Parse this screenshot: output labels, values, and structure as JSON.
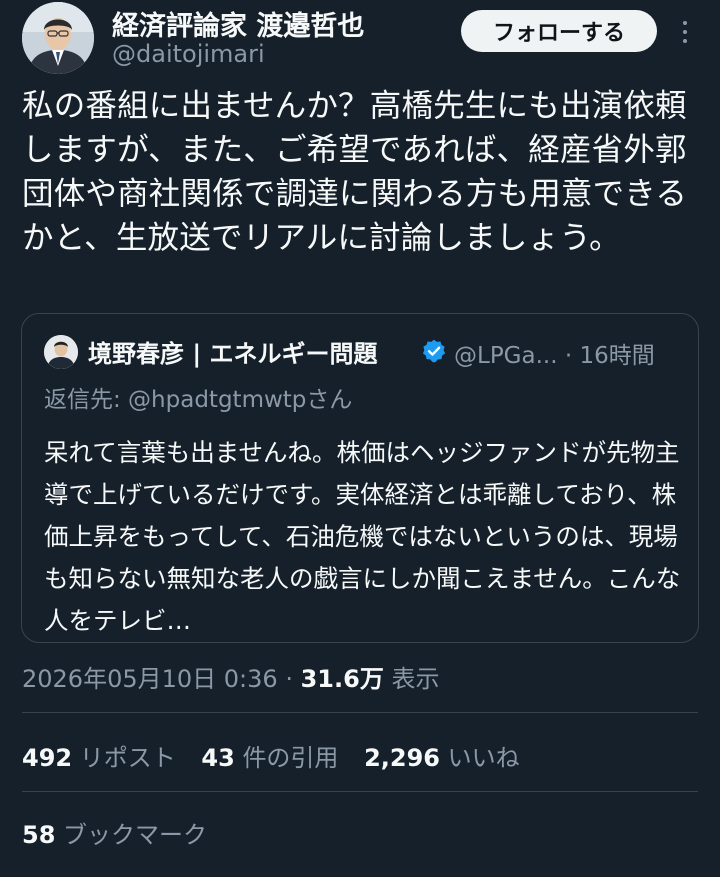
{
  "author": {
    "display_name": "経済評論家 渡邉哲也",
    "handle": "@daitojimari",
    "avatar": "man-in-suit-avatar"
  },
  "follow_label": "フォローする",
  "more_icon": "more-vertical-icon",
  "tweet": {
    "text": "私の番組に出ませんか？高橋先生にも出演依頼しますが、また、ご希望であれば、経産省外郭団体や商社関係で調達に関わる方も用意できるかと、生放送でリアルに討論しましょう。"
  },
  "quote": {
    "display_name": "境野春彦 | エネルギー問題",
    "verified": true,
    "handle_time": "@LPGa... · 16時間",
    "reply_to": "返信先: @hpadtgtmwtpさん",
    "text": "呆れて言葉も出ませんね。株価はヘッジファンドが先物主導で上げているだけです。実体経済とは乖離しており、株価上昇をもってして、石油危機ではないというのは、現場も知らない無知な老人の戯言にしか聞こえません。こんな人をテレビ…"
  },
  "meta": {
    "timestamp": "2026年05月10日 0:36",
    "separator": "·",
    "views_count": "31.6万",
    "views_label": "表示"
  },
  "stats": {
    "reposts_count": "492",
    "reposts_label": "リポスト",
    "quotes_count": "43",
    "quotes_label": "件の引用",
    "likes_count": "2,296",
    "likes_label": "いいね",
    "bookmarks_count": "58",
    "bookmarks_label": "ブックマーク"
  },
  "colors": {
    "background": "#15202b",
    "text_primary": "#f7f9f9",
    "text_secondary": "#8b98a5",
    "border": "#38444d",
    "verified_blue": "#1d9bf0",
    "follow_bg": "#eff3f4"
  }
}
